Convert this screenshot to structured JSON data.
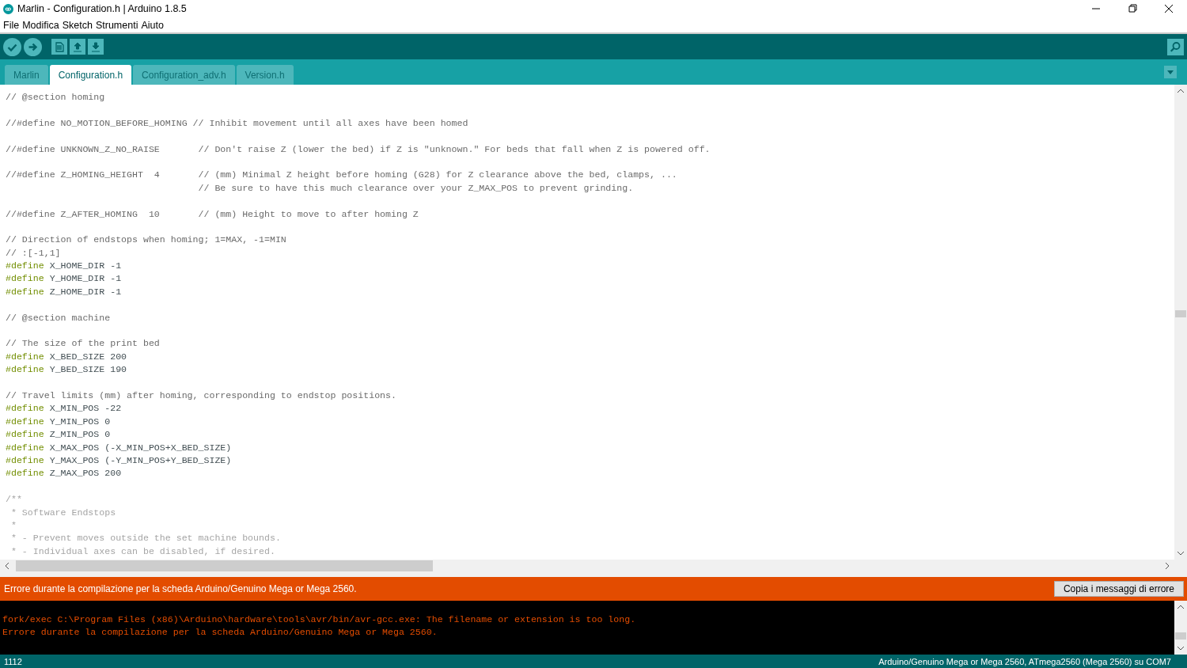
{
  "window": {
    "title": "Marlin - Configuration.h | Arduino 1.8.5"
  },
  "menu": [
    "File",
    "Modifica",
    "Sketch",
    "Strumenti",
    "Aiuto"
  ],
  "tabs": [
    {
      "label": "Marlin",
      "selected": false
    },
    {
      "label": "Configuration.h",
      "selected": true
    },
    {
      "label": "Configuration_adv.h",
      "selected": false
    },
    {
      "label": "Version.h",
      "selected": false
    }
  ],
  "editor": {
    "lines": [
      {
        "kind": "comment",
        "text": "// @section homing"
      },
      {
        "kind": "blank"
      },
      {
        "kind": "comment",
        "text": "//#define NO_MOTION_BEFORE_HOMING // Inhibit movement until all axes have been homed"
      },
      {
        "kind": "blank"
      },
      {
        "kind": "comment",
        "text": "//#define UNKNOWN_Z_NO_RAISE       // Don't raise Z (lower the bed) if Z is \"unknown.\" For beds that fall when Z is powered off."
      },
      {
        "kind": "blank"
      },
      {
        "kind": "comment",
        "text": "//#define Z_HOMING_HEIGHT  4       // (mm) Minimal Z height before homing (G28) for Z clearance above the bed, clamps, ..."
      },
      {
        "kind": "comment",
        "text": "                                   // Be sure to have this much clearance over your Z_MAX_POS to prevent grinding."
      },
      {
        "kind": "blank"
      },
      {
        "kind": "comment",
        "text": "//#define Z_AFTER_HOMING  10       // (mm) Height to move to after homing Z"
      },
      {
        "kind": "blank"
      },
      {
        "kind": "comment",
        "text": "// Direction of endstops when homing; 1=MAX, -1=MIN"
      },
      {
        "kind": "comment",
        "text": "// :[-1,1]"
      },
      {
        "kind": "define",
        "keyword": "#define",
        "text": "X_HOME_DIR -1"
      },
      {
        "kind": "define",
        "keyword": "#define",
        "text": "Y_HOME_DIR -1"
      },
      {
        "kind": "define",
        "keyword": "#define",
        "text": "Z_HOME_DIR -1"
      },
      {
        "kind": "blank"
      },
      {
        "kind": "comment",
        "text": "// @section machine"
      },
      {
        "kind": "blank"
      },
      {
        "kind": "comment",
        "text": "// The size of the print bed"
      },
      {
        "kind": "define",
        "keyword": "#define",
        "text": "X_BED_SIZE 200"
      },
      {
        "kind": "define",
        "keyword": "#define",
        "text": "Y_BED_SIZE 190"
      },
      {
        "kind": "blank"
      },
      {
        "kind": "comment",
        "text": "// Travel limits (mm) after homing, corresponding to endstop positions."
      },
      {
        "kind": "define",
        "keyword": "#define",
        "text": "X_MIN_POS -22"
      },
      {
        "kind": "define",
        "keyword": "#define",
        "text": "Y_MIN_POS 0"
      },
      {
        "kind": "define",
        "keyword": "#define",
        "text": "Z_MIN_POS 0"
      },
      {
        "kind": "define",
        "keyword": "#define",
        "text": "X_MAX_POS (-X_MIN_POS+X_BED_SIZE)"
      },
      {
        "kind": "define",
        "keyword": "#define",
        "text": "Y_MAX_POS (-Y_MIN_POS+Y_BED_SIZE)"
      },
      {
        "kind": "define",
        "keyword": "#define",
        "text": "Z_MAX_POS 200"
      },
      {
        "kind": "blank"
      },
      {
        "kind": "doc",
        "text": "/**"
      },
      {
        "kind": "doc",
        "text": " * Software Endstops"
      },
      {
        "kind": "doc",
        "text": " *"
      },
      {
        "kind": "doc",
        "text": " * - Prevent moves outside the set machine bounds."
      },
      {
        "kind": "doc",
        "text": " * - Individual axes can be disabled, if desired."
      }
    ]
  },
  "status": {
    "message": "Errore durante la compilazione per la scheda Arduino/Genuino Mega or Mega 2560.",
    "button": "Copia i messaggi di errore"
  },
  "console": {
    "lines": [
      "fork/exec C:\\Program Files (x86)\\Arduino\\hardware\\tools\\avr/bin/avr-gcc.exe: The filename or extension is too long.",
      "Errore durante la compilazione per la scheda Arduino/Genuino Mega or Mega 2560."
    ]
  },
  "footer": {
    "line": "1112",
    "board": "Arduino/Genuino Mega or Mega 2560, ATmega2560 (Mega 2560) su COM7"
  }
}
